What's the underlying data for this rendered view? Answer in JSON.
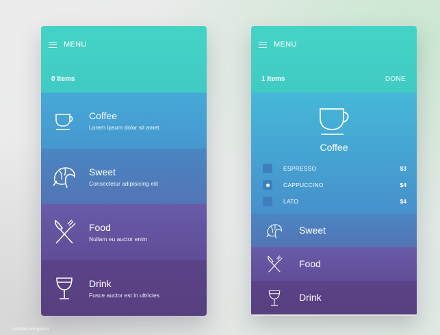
{
  "left": {
    "menu_label": "MENU",
    "items_count": "0 Items",
    "categories": [
      {
        "title": "Coffee",
        "subtitle": "Lorem ipsum dolor sit amet",
        "icon": "coffee-cup-icon"
      },
      {
        "title": "Sweet",
        "subtitle": "Consectetur adipisicing elit",
        "icon": "croissant-icon"
      },
      {
        "title": "Food",
        "subtitle": "Nullam eu auctor enim",
        "icon": "fork-knife-icon"
      },
      {
        "title": "Drink",
        "subtitle": "Fusce auctor est in ultricies",
        "icon": "wine-glass-icon"
      }
    ]
  },
  "right": {
    "menu_label": "MENU",
    "items_count": "1 Items",
    "done_label": "DONE",
    "coffee": {
      "title": "Coffee",
      "options": [
        {
          "name": "ESPRESSO",
          "price": "$3",
          "checked": false
        },
        {
          "name": "CAPPUCCINO",
          "price": "$4",
          "checked": true
        },
        {
          "name": "LATO",
          "price": "$4",
          "checked": false
        }
      ]
    },
    "categories": [
      {
        "title": "Sweet",
        "icon": "croissant-icon"
      },
      {
        "title": "Food",
        "icon": "fork-knife-icon"
      },
      {
        "title": "Drink",
        "icon": "wine-glass-icon"
      }
    ]
  },
  "credit": "dribbble.com/gaishir",
  "colors": {
    "header": "#45d3c6",
    "coffee": "#46a9d7",
    "sweet": "#4a86c2",
    "food": "#6a5aa7",
    "drink": "#5b4288"
  }
}
